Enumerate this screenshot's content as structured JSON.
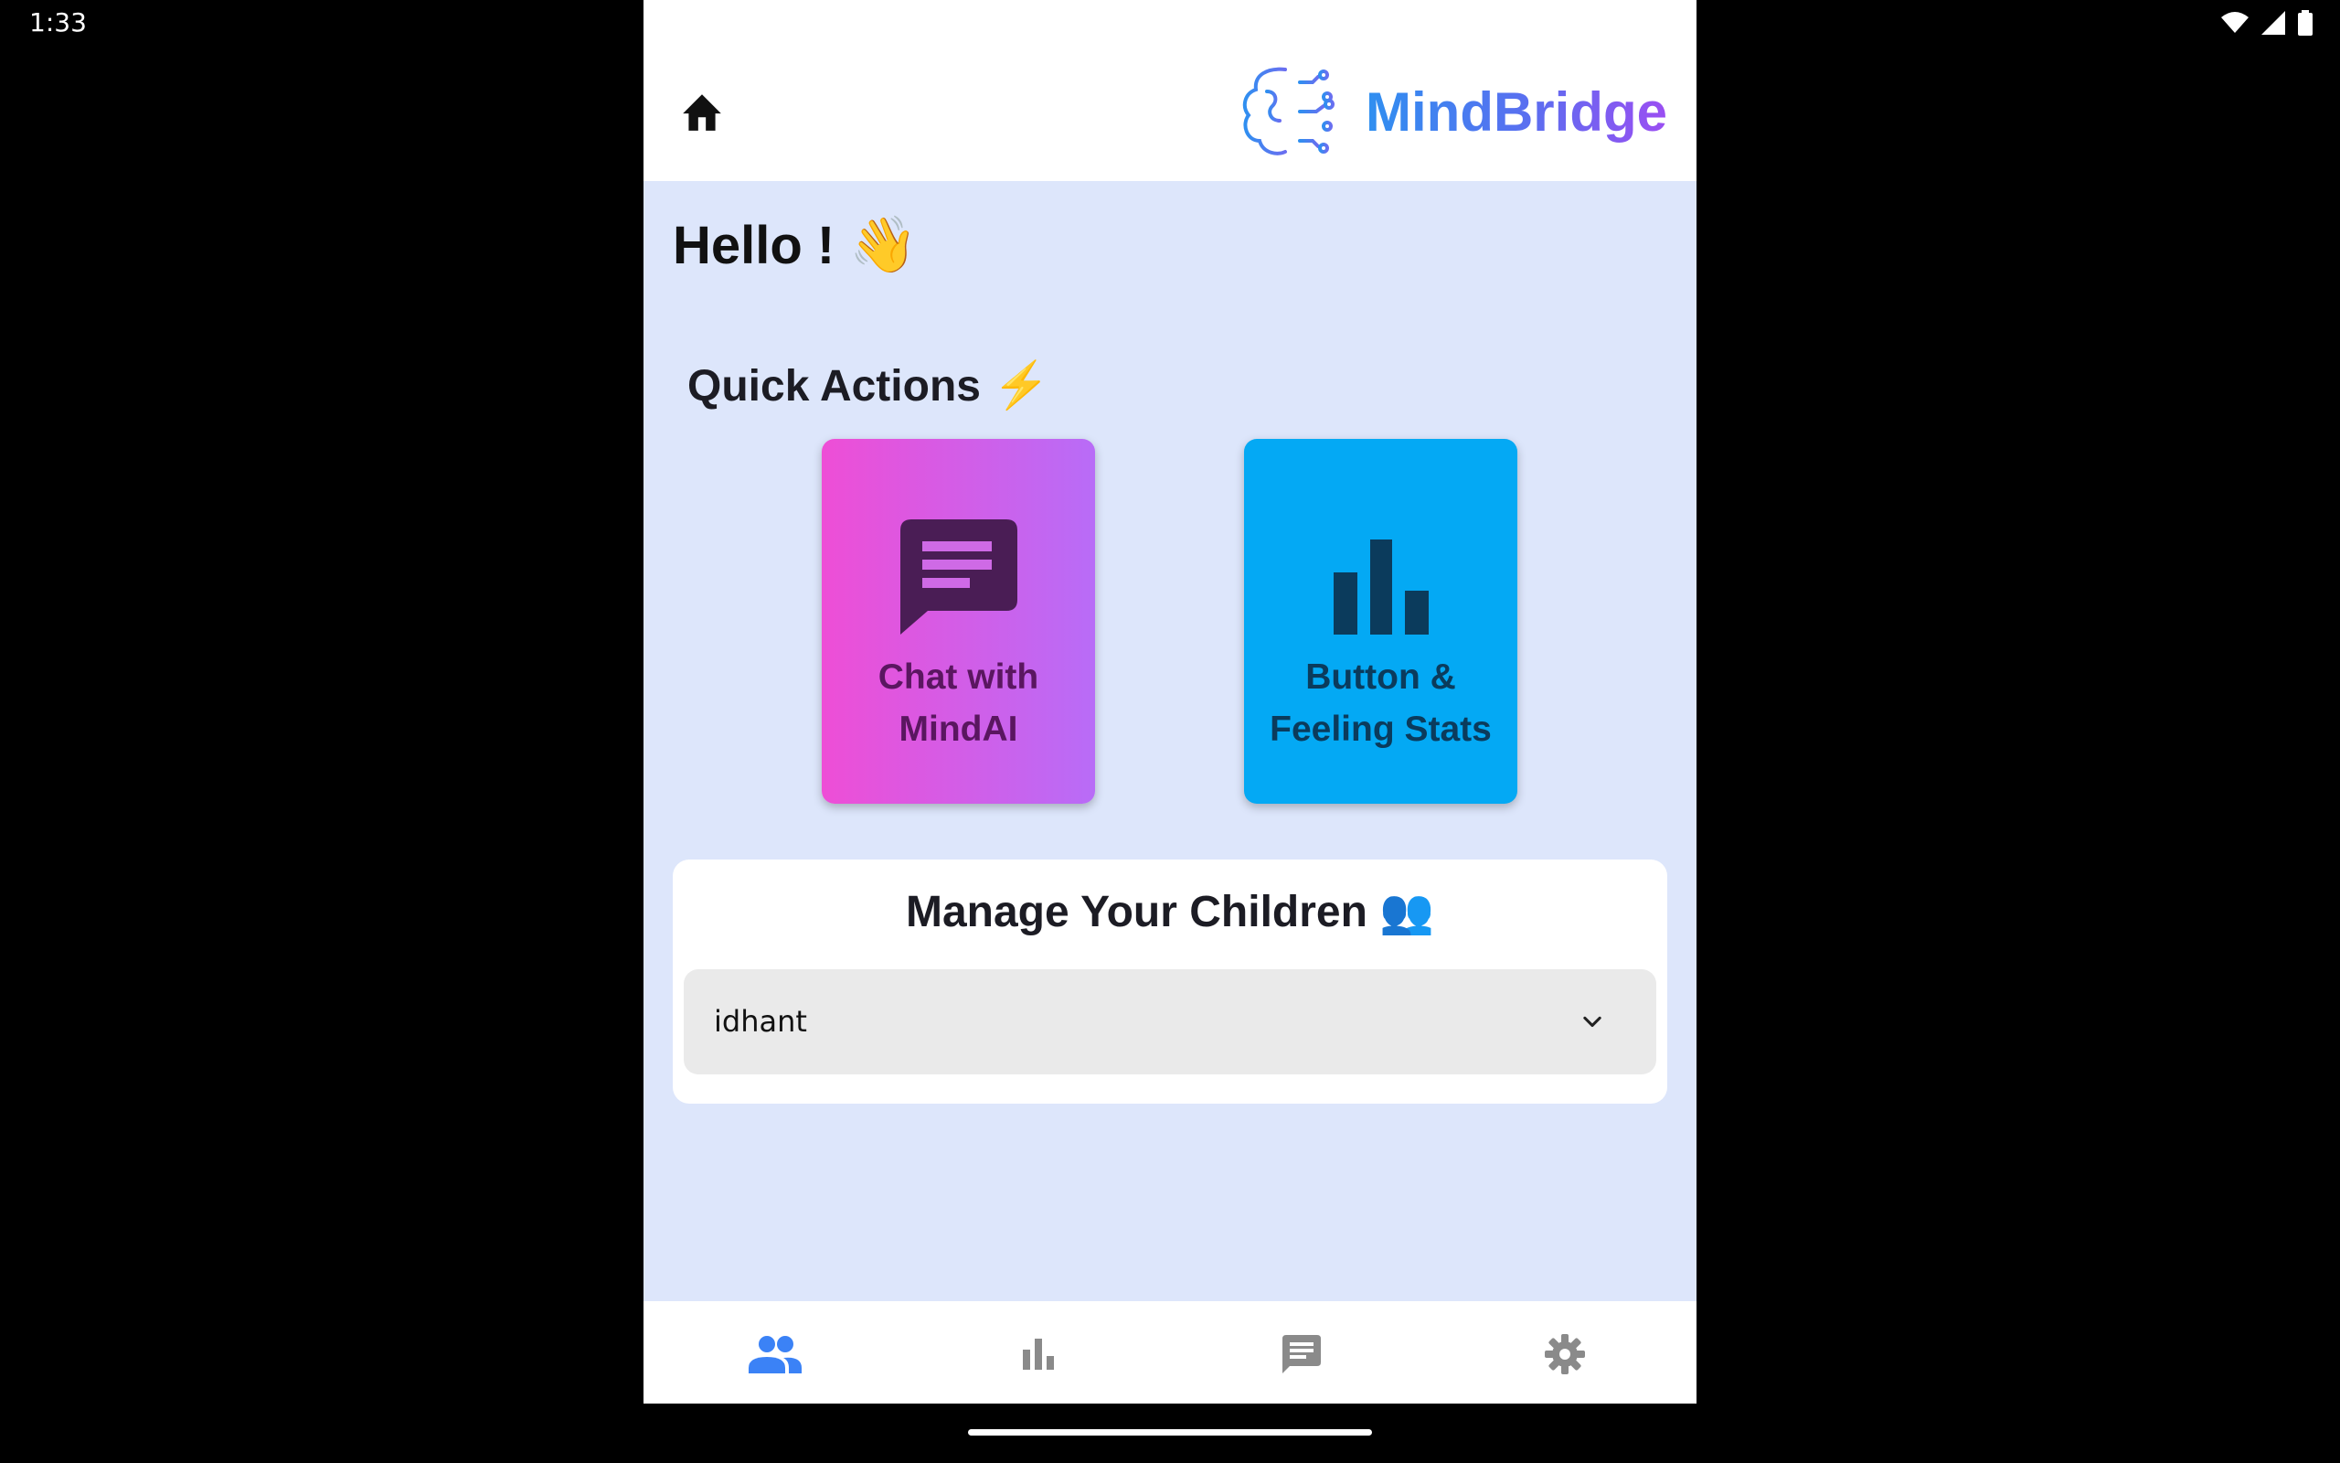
{
  "status_bar": {
    "time": "1:33",
    "icons": [
      "wifi-icon",
      "signal-icon",
      "battery-icon"
    ]
  },
  "header": {
    "home_icon": "home-icon",
    "logo_icon": "brain-circuit-icon",
    "brand_name": "MindBridge"
  },
  "greeting": {
    "text": "Hello !",
    "emoji": "👋"
  },
  "quick_actions": {
    "heading": "Quick Actions",
    "heading_emoji": "⚡",
    "cards": [
      {
        "icon": "chat-icon",
        "line1": "Chat with",
        "line2": "MindAI",
        "colors": [
          "#ee4ed6",
          "#b86cf7"
        ]
      },
      {
        "icon": "bar-chart-icon",
        "line1": "Button &",
        "line2": "Feeling Stats",
        "color": "#04a9f4"
      }
    ]
  },
  "manage_children": {
    "title": "Manage Your Children",
    "title_emoji": "👥",
    "selected_child": "idhant"
  },
  "bottom_nav": {
    "items": [
      {
        "icon": "people-icon",
        "active": true
      },
      {
        "icon": "bar-chart-icon",
        "active": false
      },
      {
        "icon": "chat-icon",
        "active": false
      },
      {
        "icon": "settings-icon",
        "active": false
      }
    ],
    "active_color": "#3b82f6",
    "inactive_color": "#8a8a8a"
  }
}
